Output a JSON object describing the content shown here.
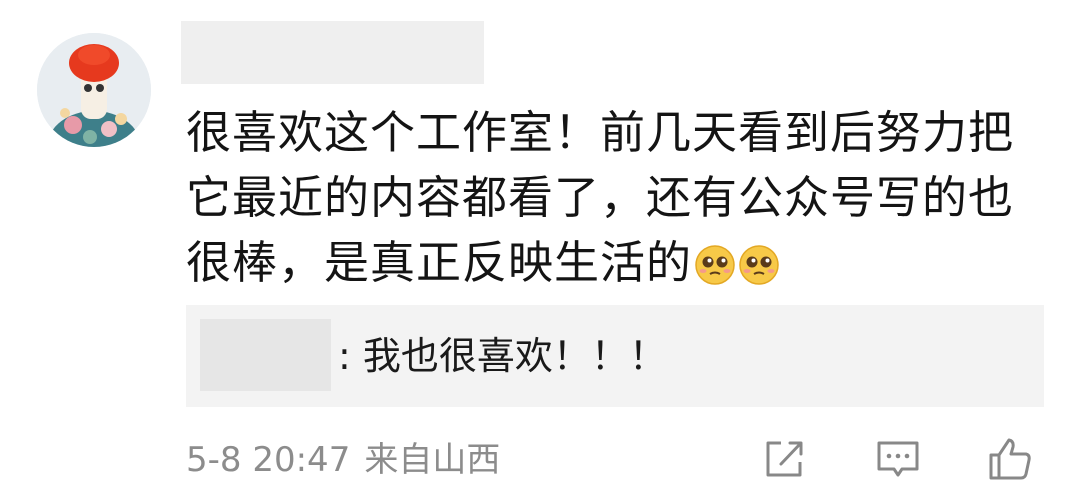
{
  "comment": {
    "avatar_icon": "user-avatar",
    "text": "很喜欢这个工作室！前几天看到后努力把它最近的内容都看了，还有公众号写的也很棒，是真正反映生活的",
    "emojis": [
      "pleading-face-icon",
      "pleading-face-icon"
    ]
  },
  "reply": {
    "text": ": 我也很喜欢！！！"
  },
  "meta": {
    "time": "5-8 20:47",
    "location": "来自山西"
  },
  "actions": {
    "forward_icon": "share-edit-icon",
    "comment_icon": "comment-icon",
    "like_icon": "thumbs-up-icon"
  },
  "colors": {
    "text": "#141414",
    "meta": "#8c8c8c",
    "reply_bg": "#f3f3f3",
    "mask": "#efefef"
  }
}
